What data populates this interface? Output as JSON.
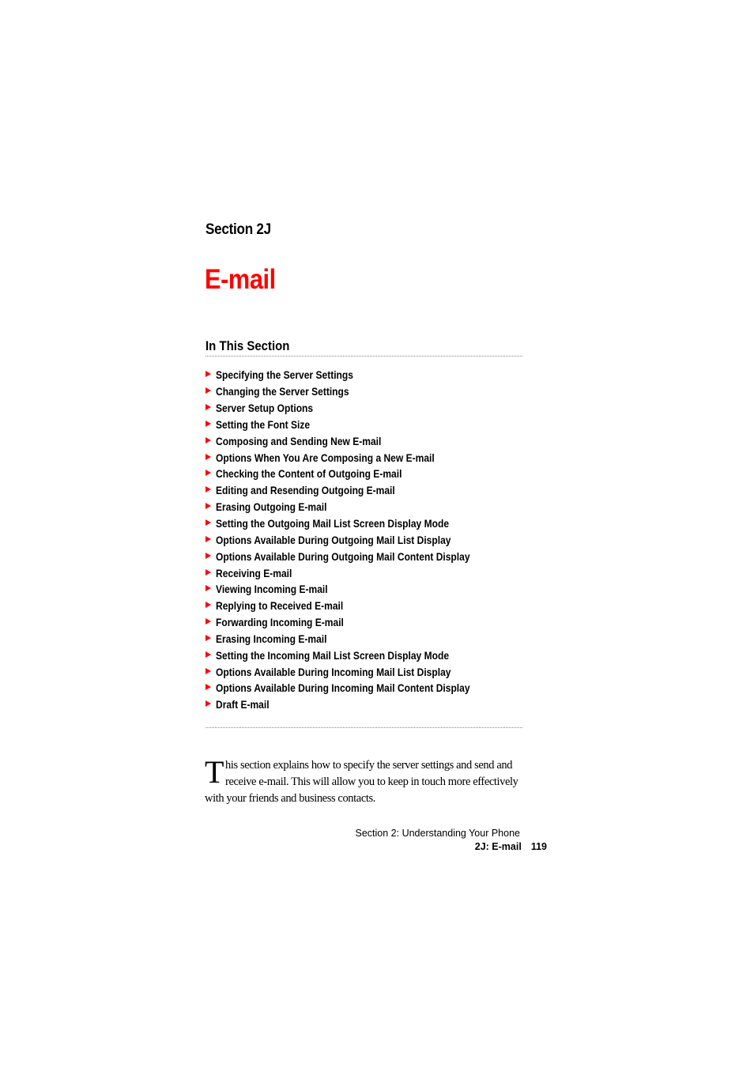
{
  "header": {
    "section_label": "Section 2J",
    "title": "E-mail",
    "title_color": "#ff0000"
  },
  "in_this_section": {
    "heading": "In This Section",
    "bullet_icon": "red-triangle-arrow-icon",
    "items": [
      "Specifying the Server Settings",
      "Changing the Server Settings",
      "Server Setup Options",
      "Setting the Font Size",
      "Composing and Sending New E-mail",
      "Options When You Are Composing a New E-mail",
      "Checking the Content of Outgoing E-mail",
      "Editing and Resending Outgoing E-mail",
      "Erasing Outgoing E-mail",
      "Setting the Outgoing Mail List Screen Display Mode",
      "Options Available During Outgoing Mail List Display",
      "Options Available During Outgoing Mail Content Display",
      "Receiving E-mail",
      "Viewing Incoming E-mail",
      "Replying to Received E-mail",
      "Forwarding Incoming E-mail",
      "Erasing Incoming E-mail",
      "Setting the Incoming Mail List Screen Display Mode",
      "Options Available During Incoming Mail List Display",
      "Options Available During Incoming Mail Content Display",
      "Draft E-mail"
    ]
  },
  "intro": {
    "dropcap": "T",
    "text": "his section explains how to specify the server settings and send and receive e-mail. This will allow you to keep in touch more effectively with your friends and business contacts."
  },
  "footer": {
    "chapter": "Section 2: Understanding Your Phone",
    "section": "2J: E-mail",
    "page_number": "119"
  }
}
